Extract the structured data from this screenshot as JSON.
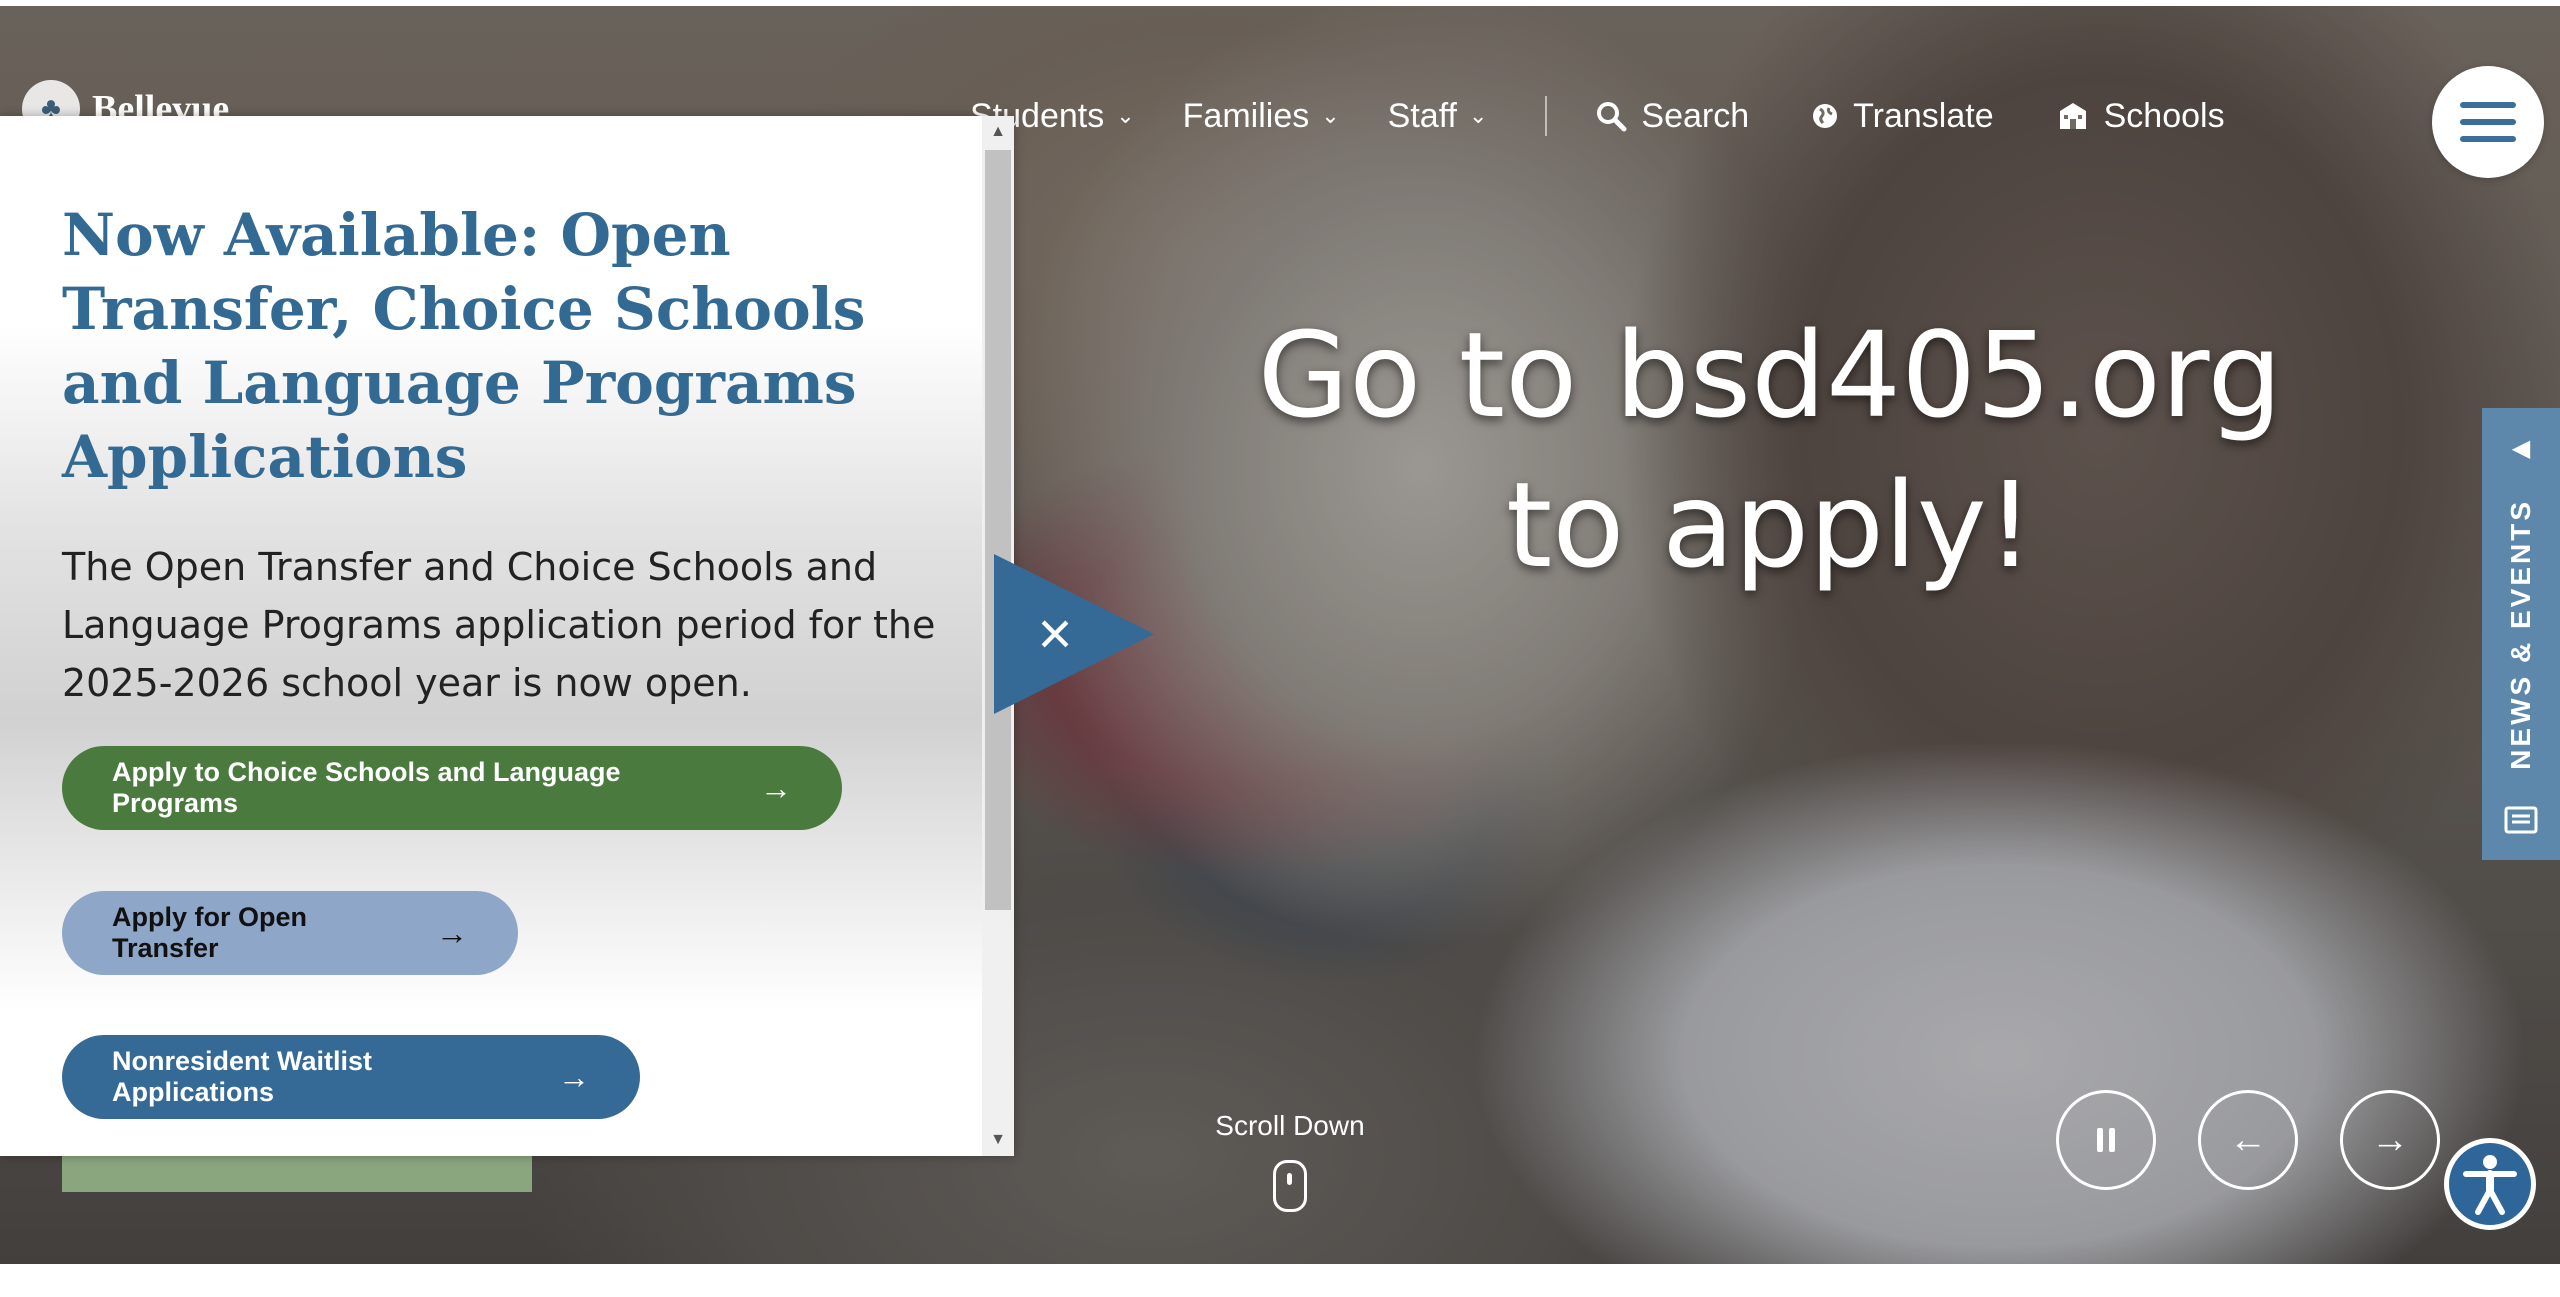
{
  "header": {
    "logo_text": "Bellevue",
    "nav": [
      {
        "label": "Students"
      },
      {
        "label": "Families"
      },
      {
        "label": "Staff"
      }
    ],
    "utility": {
      "search": "Search",
      "translate": "Translate",
      "schools": "Schools"
    }
  },
  "hero": {
    "line1": "Go to bsd405.org",
    "line2": "to apply!",
    "side_tab": "NEWS & EVENTS",
    "scroll_label": "Scroll Down"
  },
  "modal": {
    "title": "Now Available: Open Transfer, Choice Schools and Language Programs Applications",
    "body": "The Open Transfer and Choice Schools and Language Programs application period for the 2025-2026 school year is now open.",
    "buttons": [
      {
        "label": "Apply to Choice Schools and Language Programs"
      },
      {
        "label": "Apply for Open Transfer"
      },
      {
        "label": "Nonresident Waitlist Applications"
      }
    ]
  },
  "colors": {
    "primary_blue": "#356a97",
    "title_blue": "#336a93",
    "green": "#4a7a3e",
    "light_blue": "#8ea6c8",
    "tab_blue": "#5d88ac"
  }
}
